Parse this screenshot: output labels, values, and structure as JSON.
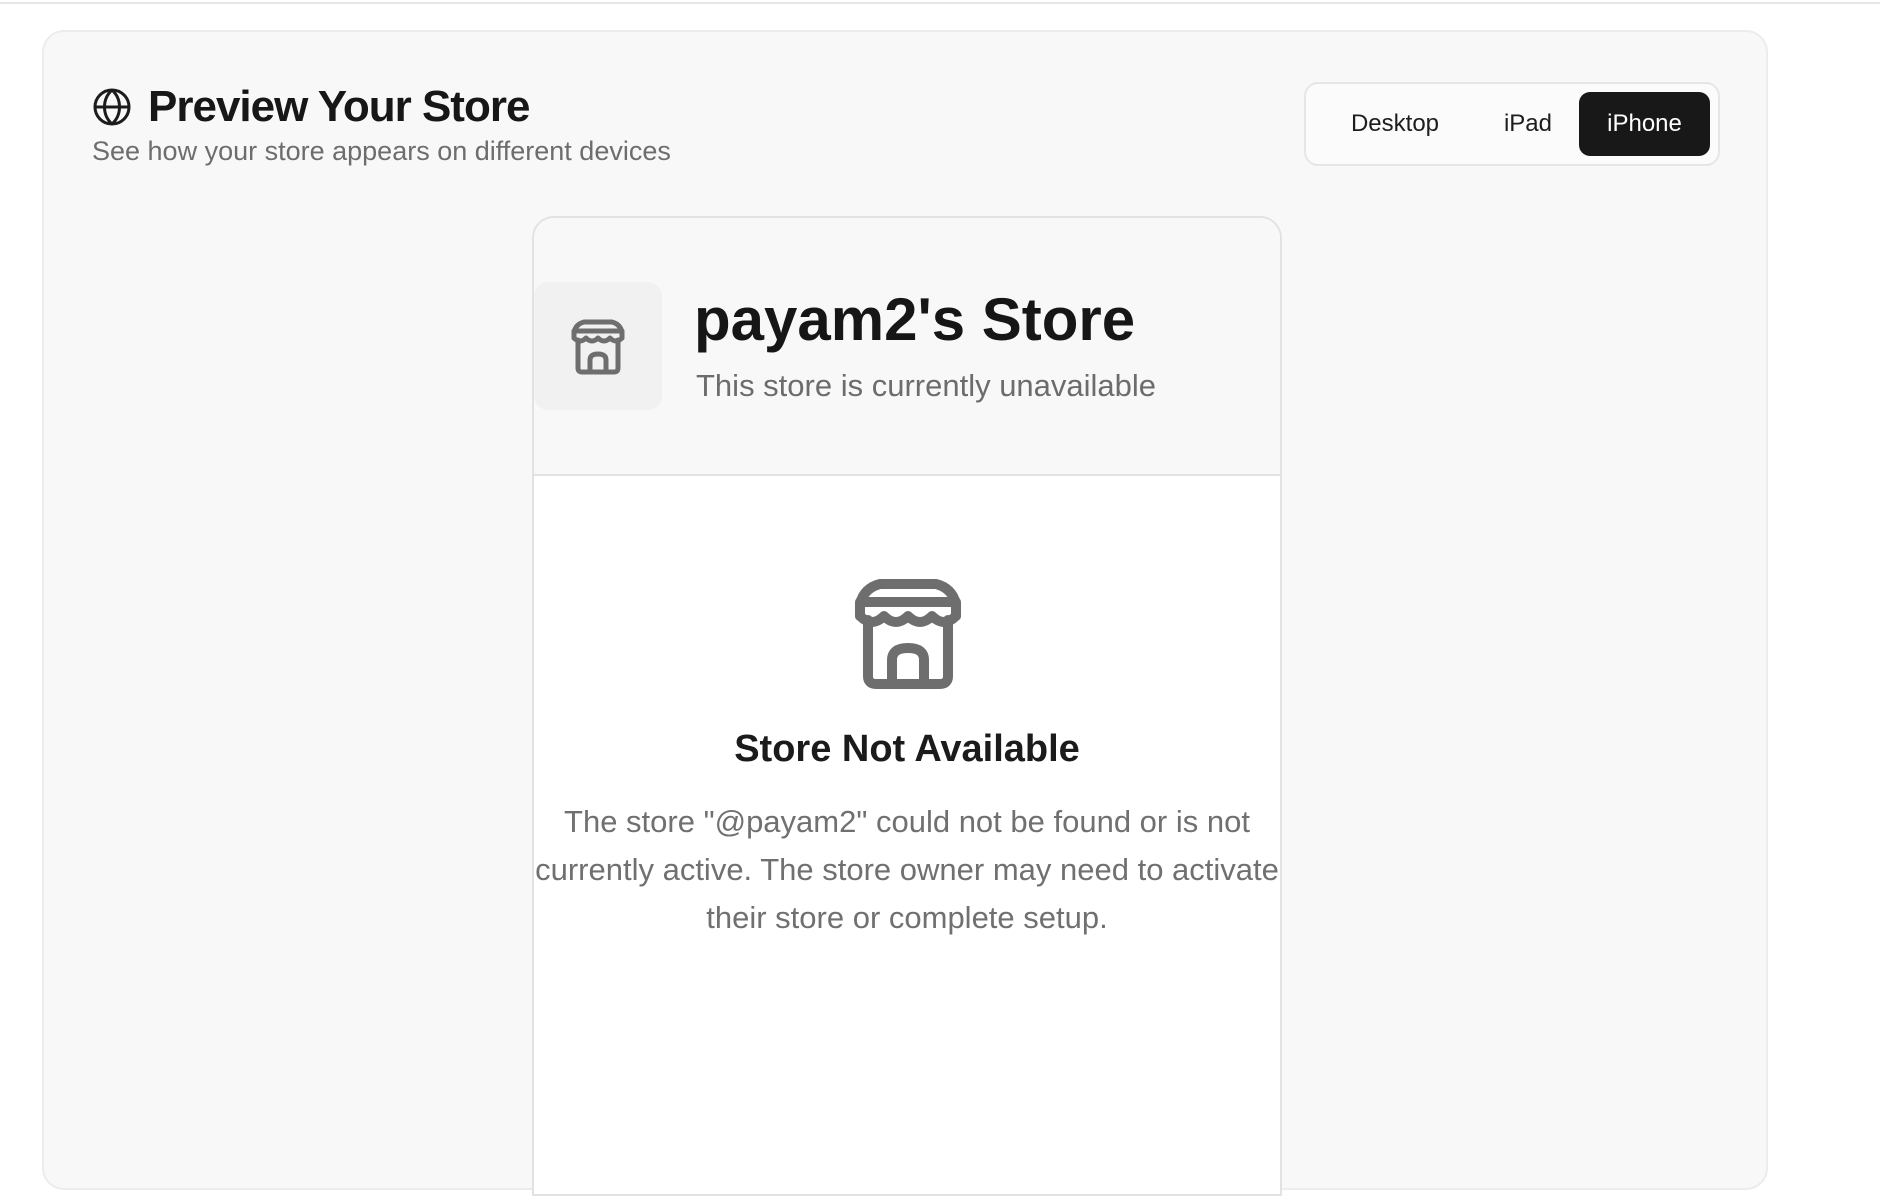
{
  "header": {
    "title": "Preview Your Store",
    "subtitle": "See how your store appears on different devices",
    "icon": "globe-icon"
  },
  "device_switcher": {
    "options": [
      {
        "label": "Desktop",
        "selected": false
      },
      {
        "label": "iPad",
        "selected": false
      },
      {
        "label": "iPhone",
        "selected": true
      }
    ]
  },
  "store_preview": {
    "logo_icon": "store-icon",
    "store_name": "payam2's Store",
    "status_text": "This store is currently unavailable",
    "empty_state": {
      "icon": "store-icon",
      "title": "Store Not Available",
      "message": "The store \"@payam2\" could not be found or is not currently active. The store owner may need to activate their store or complete setup."
    }
  },
  "colors": {
    "selected_tab_bg": "#181818",
    "card_bg": "#f8f8f8",
    "muted_text": "#6d6d6d"
  }
}
